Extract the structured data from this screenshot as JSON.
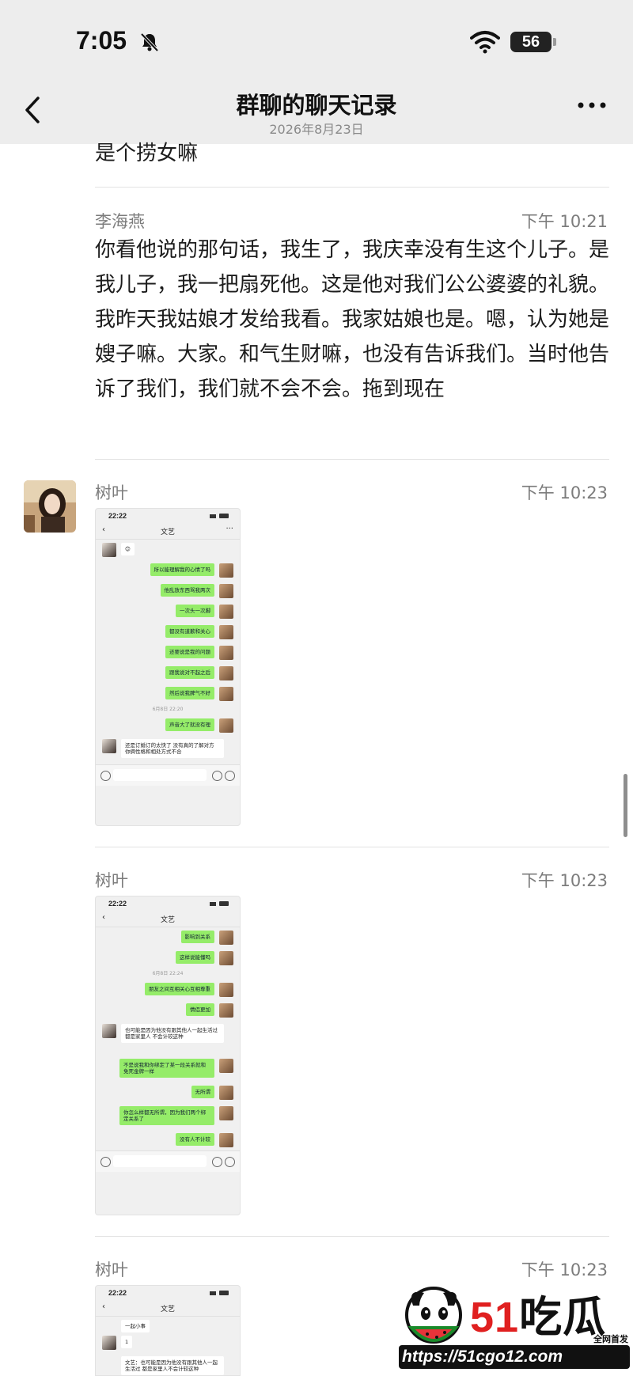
{
  "status_bar": {
    "time": "7:05",
    "battery": "56"
  },
  "nav": {
    "title": "群聊的聊天记录",
    "date": "2026年8月23日"
  },
  "previous_message_tail": "是个捞女嘛",
  "messages": [
    {
      "sender": "李海燕",
      "time": "下午 10:21",
      "text": "你看他说的那句话，我生了，我庆幸没有生这个儿子。是我儿子，我一把扇死他。这是他对我们公公婆婆的礼貌。我昨天我姑娘才发给我看。我家姑娘也是。嗯，认为她是嫂子嘛。大家。和气生财嘛，也没有告诉我们。当时他告诉了我们，我们就不会不会。拖到现在"
    },
    {
      "sender": "树叶",
      "time": "下午 10:23",
      "screenshot": {
        "time": "22:22",
        "contact": "文艺",
        "rows": [
          {
            "side": "left",
            "text": "😊"
          },
          {
            "side": "right",
            "text": "所以能理解我的心情了吗"
          },
          {
            "side": "right",
            "text": "他乱放东西骂我两次"
          },
          {
            "side": "right",
            "text": "一次头一次脚"
          },
          {
            "side": "right",
            "text": "都没有道歉和关心"
          },
          {
            "side": "right",
            "text": "还要说是我的问题"
          },
          {
            "side": "right",
            "text": "跟我说对不起之后"
          },
          {
            "side": "right",
            "text": "然后说我脾气不好"
          },
          {
            "side": "stamp",
            "text": "6月8日 22:20"
          },
          {
            "side": "right",
            "text": "声音大了就没有理"
          },
          {
            "side": "left",
            "text": "还是订婚订的太快了 没有真的了解对方 你俩性格和相处方式不合"
          }
        ]
      }
    },
    {
      "sender": "树叶",
      "time": "下午 10:23",
      "screenshot": {
        "time": "22:22",
        "contact": "文艺",
        "rows": [
          {
            "side": "right",
            "text": "影响到关系"
          },
          {
            "side": "right",
            "text": "这样说能懂吗"
          },
          {
            "side": "stamp",
            "text": "6月8日 22:24"
          },
          {
            "side": "right",
            "text": "朋友之间互相关心互相尊重"
          },
          {
            "side": "right",
            "text": "情侣更加"
          },
          {
            "side": "left",
            "text": "也可能是因为他没有跟其他人一起生活过 都是家里人 不会计较这种"
          },
          {
            "side": "right",
            "text": "不是说我和你绑定了某一段关系就和免死金牌一样"
          },
          {
            "side": "right",
            "text": "无所谓"
          },
          {
            "side": "right",
            "text": "你怎么样都无所谓，因为我们两个绑定关系了"
          },
          {
            "side": "right",
            "text": "没有人不计较"
          }
        ]
      }
    },
    {
      "sender": "树叶",
      "time": "下午 10:23",
      "screenshot": {
        "time": "22:22",
        "contact": "文艺",
        "rows": [
          {
            "side": "left",
            "text": "一起小事"
          },
          {
            "side": "left",
            "text": "1"
          },
          {
            "side": "left",
            "text": "文艺：也可能是因为他没有跟其他人一起生活过 都是家里人不会计较这种"
          }
        ]
      }
    }
  ],
  "watermark": {
    "brand_num": "51",
    "brand_text": "吃瓜",
    "url": "https://51cgo12.com",
    "tag": "全网首发"
  }
}
